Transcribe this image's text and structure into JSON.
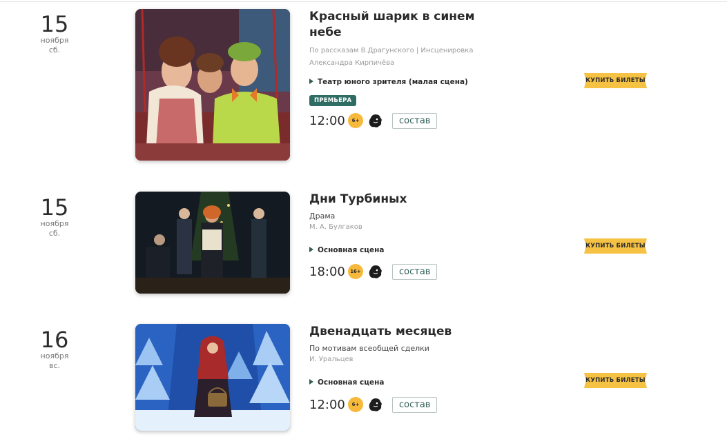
{
  "events": [
    {
      "day": "15",
      "month": "ноября",
      "weekday": "сб.",
      "title": "Красный шарик в синем небе",
      "description": "По рассказам В.Драгунского | Инсценировка Александра Кирпичёва",
      "venue": "Театр юного зрителя (малая сцена)",
      "badge": "ПРЕМЬЕРА",
      "time": "12:00",
      "age": "6+",
      "cast_label": "состав",
      "buy_label": "КУПИТЬ БИЛЕТЫ"
    },
    {
      "day": "15",
      "month": "ноября",
      "weekday": "сб.",
      "title": "Дни Турбиных",
      "genre": "Драма",
      "author": "М. А. Булгаков",
      "venue": "Основная сцена",
      "time": "18:00",
      "age": "16+",
      "cast_label": "состав",
      "buy_label": "КУПИТЬ БИЛЕТЫ"
    },
    {
      "day": "16",
      "month": "ноября",
      "weekday": "вс.",
      "title": "Двенадцать месяцев",
      "genre": "По мотивам всеобщей сделки",
      "author": "И. Уральцев",
      "venue": "Основная сцена",
      "time": "12:00",
      "age": "6+",
      "cast_label": "состав",
      "buy_label": "КУПИТЬ БИЛЕТЫ"
    }
  ],
  "colors": {
    "accent": "#2f6d64",
    "ticket": "#f6c244",
    "age_badge": "#f6b93b"
  },
  "icons": [
    "pushkin-card-icon",
    "play-triangle-icon"
  ]
}
